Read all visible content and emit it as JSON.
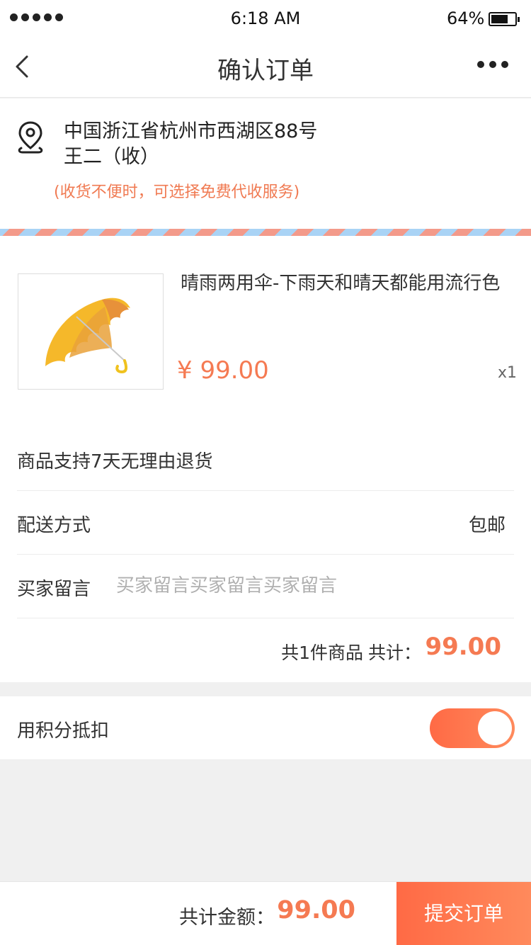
{
  "status_bar": {
    "time": "6:18 AM",
    "battery_percent": "64%",
    "battery_level": 0.64
  },
  "nav": {
    "title": "确认订单",
    "back_icon": "chevron-left-icon",
    "more_icon": "more-horizontal-icon"
  },
  "address": {
    "icon": "location-pin-icon",
    "line": "中国浙江省杭州市西湖区88号",
    "name": "王二（收）",
    "note": "(收货不便时，可选择免费代收服务)"
  },
  "product": {
    "image": "umbrella-image",
    "name": "晴雨两用伞-下雨天和晴天都能用流行色",
    "price": "¥ 99.00",
    "quantity": "x1"
  },
  "return_policy": "商品支持7天无理由退货",
  "delivery": {
    "label": "配送方式",
    "value": "包邮"
  },
  "message": {
    "label": "买家留言",
    "placeholder": "买家留言买家留言买家留言"
  },
  "summary": {
    "count_text": "共1件商品",
    "total_label": "共计：",
    "total_amount": "99.00"
  },
  "points": {
    "label": "用积分抵扣",
    "enabled": true
  },
  "footer": {
    "total_label": "共计金额：",
    "total_amount": "99.00",
    "submit_label": "提交订单"
  },
  "colors": {
    "accent": "#f57a52",
    "gradient_start": "#ff6a45",
    "gradient_end": "#ff8a5c",
    "stripe_red": "#f39a8a",
    "stripe_blue": "#a9d3f5"
  }
}
